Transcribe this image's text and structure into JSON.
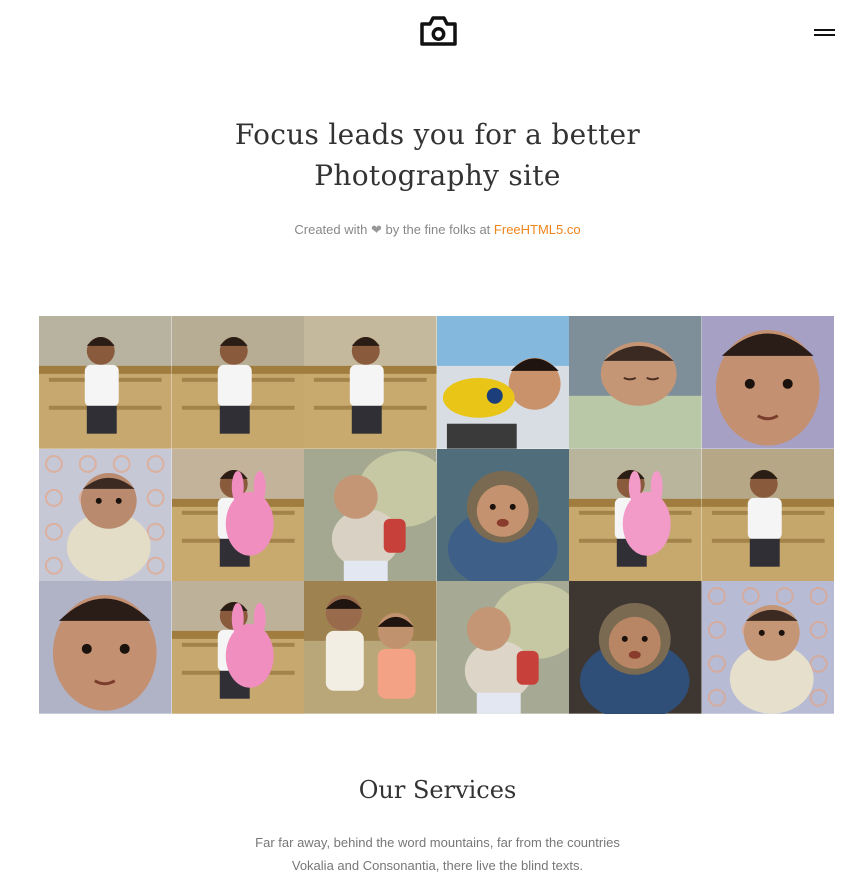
{
  "header": {
    "logo_icon": "camera-icon",
    "menu_icon": "hamburger-icon"
  },
  "hero": {
    "title_line1": "Focus leads you for a better",
    "title_line2": "Photography site",
    "credit_prefix": "Created with",
    "credit_icon": "heart-icon",
    "credit_middle": "by the fine folks at",
    "credit_link": "FreeHTML5.co"
  },
  "colors": {
    "accent": "#f0841b",
    "text": "#333333",
    "muted": "#888888"
  },
  "gallery": {
    "tiles": [
      {
        "scene": "toddler-sofa-pose",
        "bg": "#b8b2a0",
        "subject": "#f2f2f2",
        "skin": "#8a5a3c"
      },
      {
        "scene": "toddler-sofa-pose",
        "bg": "#b7ad94",
        "subject": "#f5f5f5",
        "skin": "#8a5a3c"
      },
      {
        "scene": "toddler-sofa-pose",
        "bg": "#c4b99d",
        "subject": "#f5f5f5",
        "skin": "#8a5a3c"
      },
      {
        "scene": "baby-yellow-toy",
        "bg": "#d8dde4",
        "subject": "#e8c517",
        "skin": "#c9926a"
      },
      {
        "scene": "baby-sleeping",
        "bg": "#7f8f9a",
        "subject": "#b9c8a6",
        "skin": "#c49676"
      },
      {
        "scene": "baby-face-closeup",
        "bg": "#a6a0c4",
        "subject": "#c49072",
        "skin": "#c49072"
      },
      {
        "scene": "baby-quilt",
        "bg": "#c7c8d6",
        "subject": "#e3dcc6",
        "skin": "#b98a6e"
      },
      {
        "scene": "toddler-pink-toy",
        "bg": "#c3b39a",
        "subject": "#f08fbf",
        "skin": "#8a5a3c"
      },
      {
        "scene": "baby-pillow",
        "bg": "#a5a890",
        "subject": "#d9d2c4",
        "skin": "#c49676"
      },
      {
        "scene": "baby-hood",
        "bg": "#4f6d7a",
        "subject": "#3d5f88",
        "skin": "#c4926e"
      },
      {
        "scene": "toddler-pink-toy",
        "bg": "#b9b49c",
        "subject": "#f29ac8",
        "skin": "#8a5a3c"
      },
      {
        "scene": "toddler-sofa-pose",
        "bg": "#b6a886",
        "subject": "#f6f6f6",
        "skin": "#8a5a3c"
      },
      {
        "scene": "baby-face-closeup",
        "bg": "#b0b3c6",
        "subject": "#dcd6bf",
        "skin": "#c49072"
      },
      {
        "scene": "toddler-pink-toy",
        "bg": "#bdb19a",
        "subject": "#f08fbf",
        "skin": "#8a5a3c"
      },
      {
        "scene": "two-children",
        "bg": "#b9a77a",
        "subject": "#f3eee4",
        "skin": "#9a6a4c"
      },
      {
        "scene": "baby-pillow",
        "bg": "#a6aa94",
        "subject": "#ddd6c8",
        "skin": "#c49676"
      },
      {
        "scene": "baby-hood",
        "bg": "#3e3630",
        "subject": "#2f4e78",
        "skin": "#b88664"
      },
      {
        "scene": "baby-quilt",
        "bg": "#b7bcd4",
        "subject": "#e6dfcb",
        "skin": "#c49676"
      }
    ]
  },
  "services": {
    "title": "Our Services",
    "text_line1": "Far far away, behind the word mountains, far from the countries",
    "text_line2": "Vokalia and Consonantia, there live the blind texts."
  }
}
